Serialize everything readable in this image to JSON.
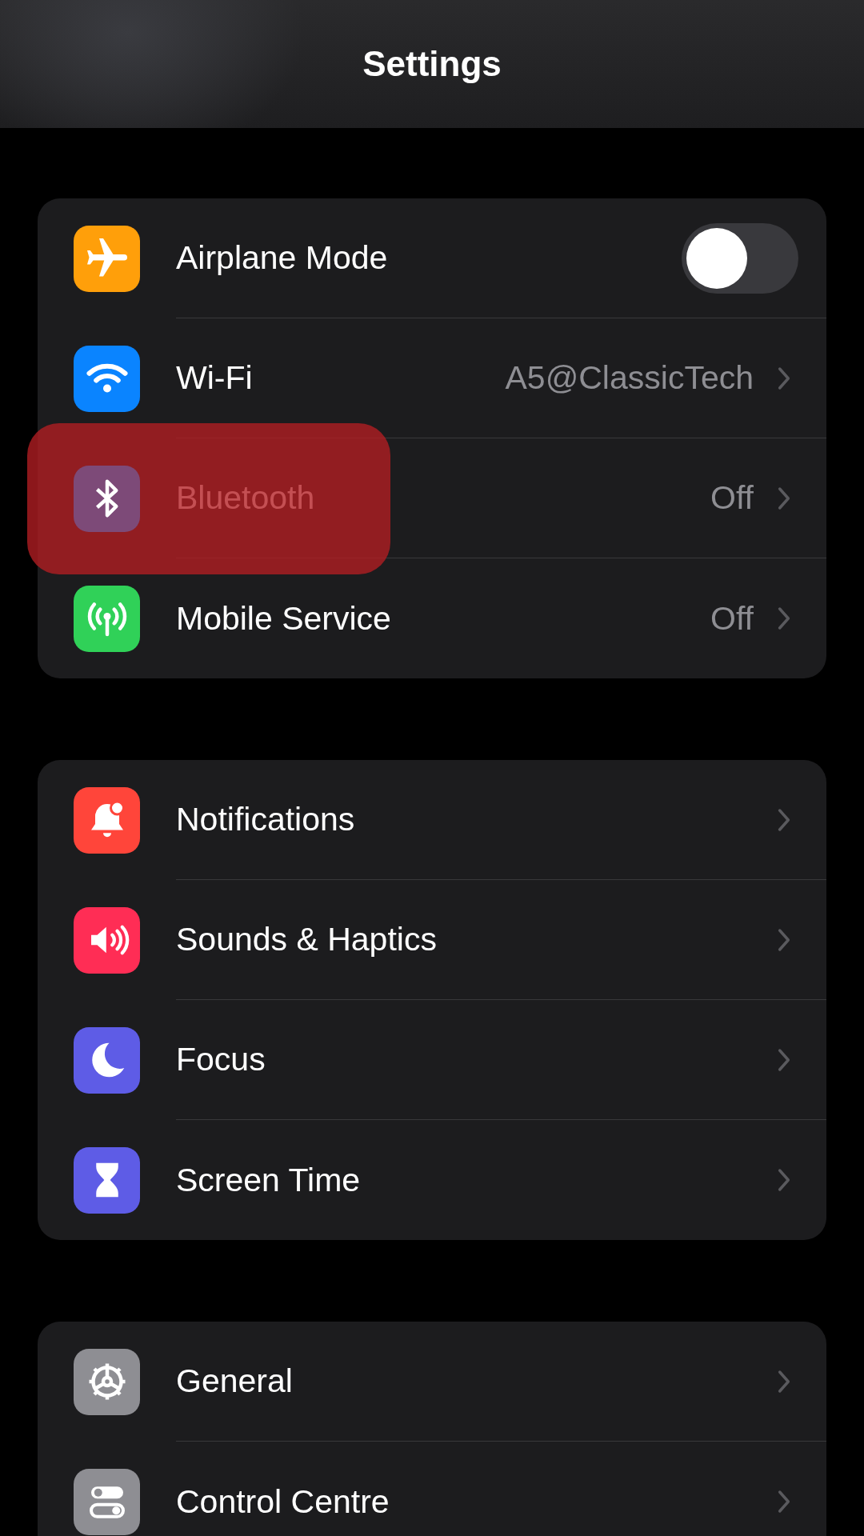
{
  "title": "Settings",
  "sections": [
    {
      "rows": [
        {
          "label": "Airplane Mode",
          "kind": "toggle",
          "on": false,
          "color": "#ff9f0a",
          "highlighted": false
        },
        {
          "label": "Wi-Fi",
          "kind": "link",
          "value": "A5@ClassicTech",
          "color": "#0a84ff",
          "highlighted": false
        },
        {
          "label": "Bluetooth",
          "kind": "link",
          "value": "Off",
          "color": "#7d4a78",
          "highlighted": true
        },
        {
          "label": "Mobile Service",
          "kind": "link",
          "value": "Off",
          "color": "#30d158",
          "highlighted": false
        }
      ]
    },
    {
      "rows": [
        {
          "label": "Notifications",
          "kind": "link",
          "color": "#ff453a",
          "highlighted": false
        },
        {
          "label": "Sounds & Haptics",
          "kind": "link",
          "color": "#ff2d55",
          "highlighted": false
        },
        {
          "label": "Focus",
          "kind": "link",
          "color": "#5e5ce6",
          "highlighted": false
        },
        {
          "label": "Screen Time",
          "kind": "link",
          "color": "#5e5ce6",
          "highlighted": false
        }
      ]
    },
    {
      "rows": [
        {
          "label": "General",
          "kind": "link",
          "color": "#8e8e93",
          "highlighted": false
        },
        {
          "label": "Control Centre",
          "kind": "link",
          "color": "#8e8e93",
          "highlighted": false
        }
      ]
    }
  ]
}
